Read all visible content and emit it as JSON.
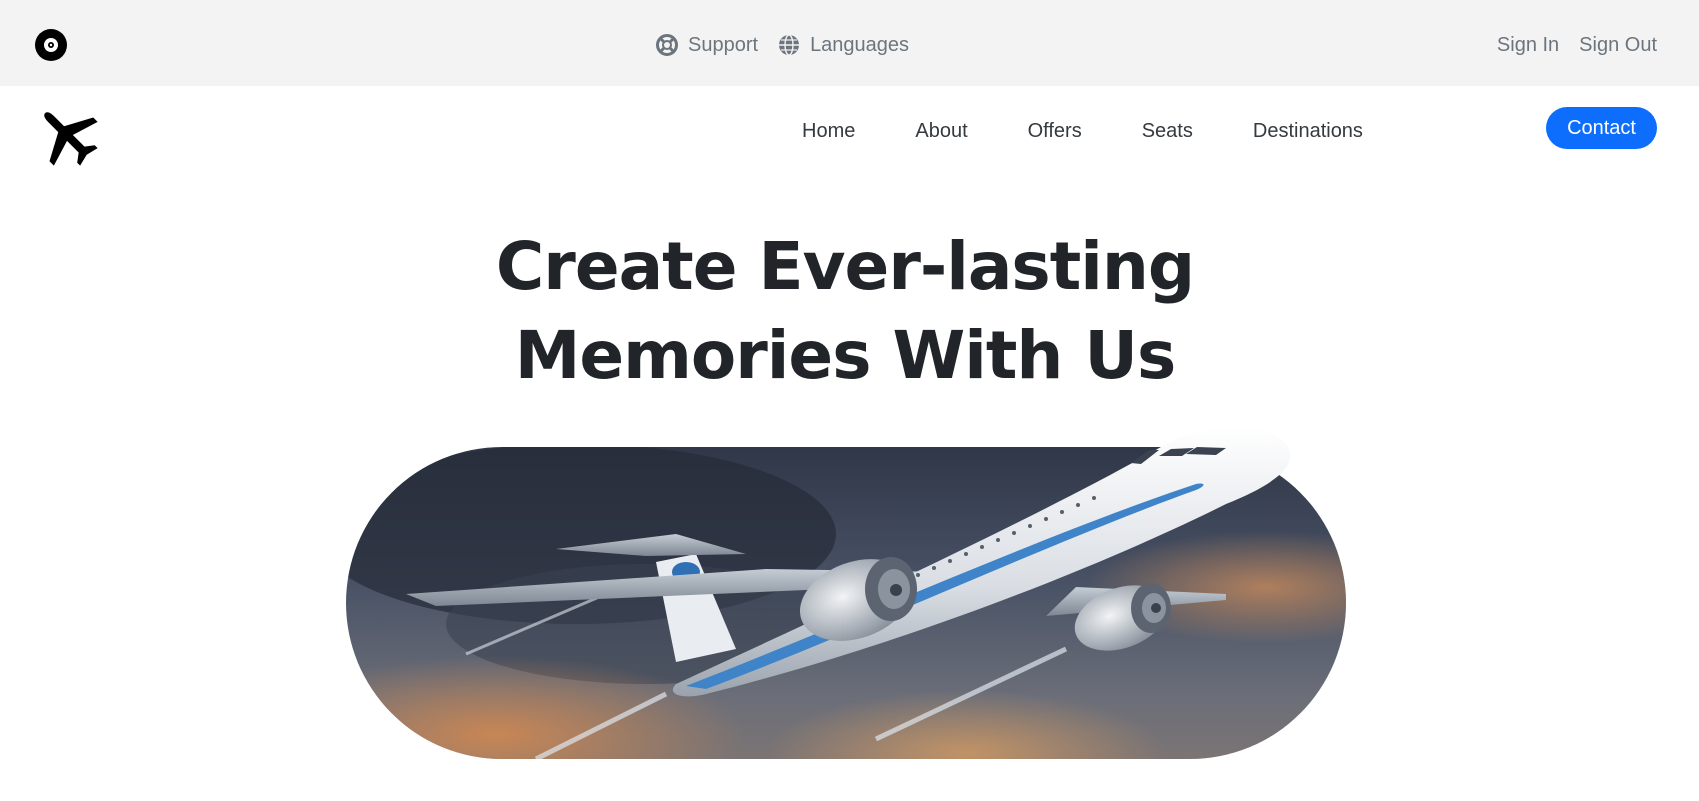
{
  "topbar": {
    "support_label": "Support",
    "languages_label": "Languages",
    "sign_in_label": "Sign In",
    "sign_out_label": "Sign Out"
  },
  "nav": {
    "items": [
      {
        "label": "Home"
      },
      {
        "label": "About"
      },
      {
        "label": "Offers"
      },
      {
        "label": "Seats"
      },
      {
        "label": "Destinations"
      }
    ],
    "contact_label": "Contact"
  },
  "hero": {
    "title_line1": "Create Ever-lasting",
    "title_line2": "Memories With Us",
    "image_alt": "airplane-flying-in-clouds"
  },
  "colors": {
    "accent": "#0d6efd",
    "topbar_bg": "#f3f3f3",
    "heading": "#212529",
    "muted": "#6c757d"
  },
  "icons": {
    "brand": "vinyl-disc-icon",
    "support": "lifebuoy-icon",
    "languages": "globe-icon",
    "logo": "airplane-icon"
  }
}
